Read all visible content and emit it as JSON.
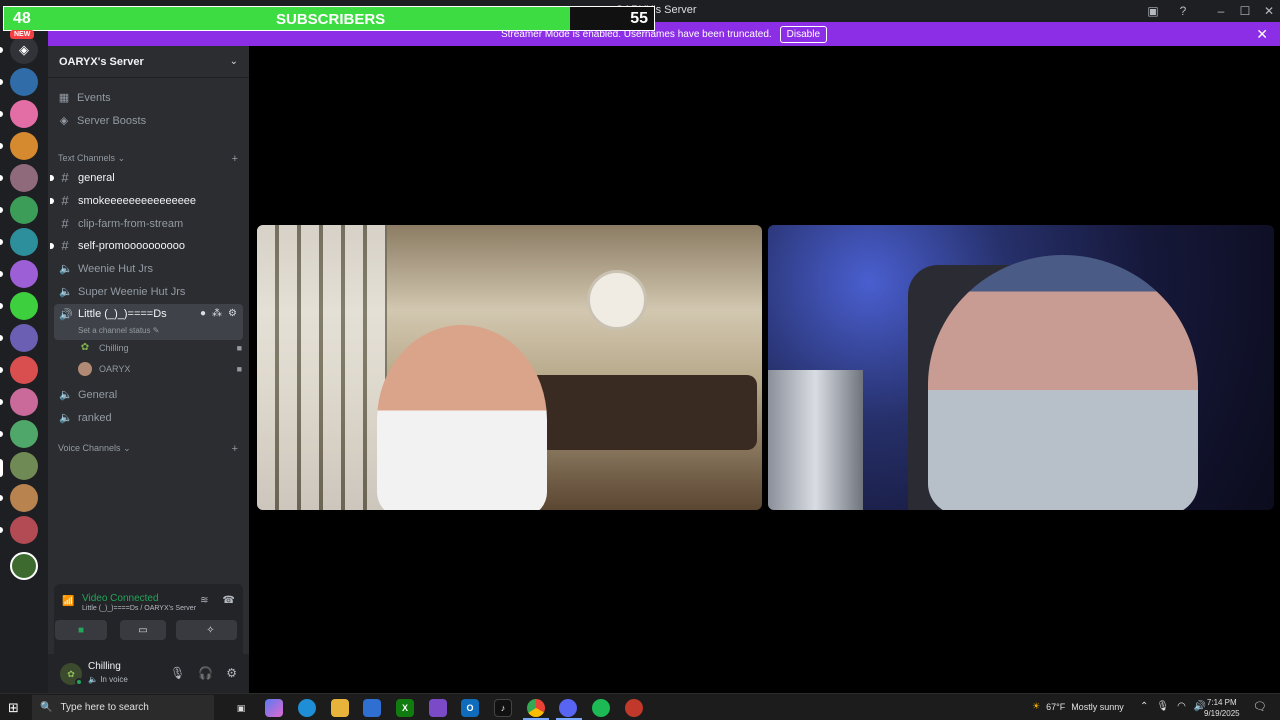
{
  "window": {
    "title": "OARYX's Server"
  },
  "overlay": {
    "count": "48",
    "label": "SUBSCRIBERS",
    "goal": "55",
    "progress": 0.87
  },
  "banner": {
    "text": "Streamer Mode is enabled. Usernames have been truncated.",
    "button": "Disable"
  },
  "rail": {
    "badge": "NEW"
  },
  "server": {
    "name": "OARYX's Server"
  },
  "nav": [
    {
      "label": "Events",
      "icon": "calendar-icon"
    },
    {
      "label": "Server Boosts",
      "icon": "boost-icon"
    }
  ],
  "categories": {
    "text": "Text Channels",
    "voice": "Voice Channels"
  },
  "channels": [
    {
      "name": "general",
      "type": "text",
      "unread": true
    },
    {
      "name": "smokeeeeeeeeeeeeeee",
      "type": "text",
      "unread": true
    },
    {
      "name": "clip-farm-from-stream",
      "type": "text",
      "unread": false
    },
    {
      "name": "self-promoooooooooo",
      "type": "text",
      "unread": true
    },
    {
      "name": "Weenie Hut Jrs",
      "type": "voice",
      "unread": false
    },
    {
      "name": "Super Weenie Hut Jrs",
      "type": "voice",
      "unread": false
    }
  ],
  "active_channel": {
    "name": "Little (_)_)====Ds",
    "status": "Set a channel status",
    "members": [
      {
        "name": "Chilling"
      },
      {
        "name": "OARYX"
      }
    ]
  },
  "more_channels": [
    {
      "name": "General"
    },
    {
      "name": "ranked"
    }
  ],
  "voice_panel": {
    "title": "Video Connected",
    "subtitle": "Little (_)_)====Ds / OARYX's Server"
  },
  "user": {
    "name": "Chilling",
    "status": "In voice"
  },
  "taskbar": {
    "search_placeholder": "Type here to search",
    "weather": {
      "temp": "67°F",
      "desc": "Mostly sunny"
    },
    "time": "7:14 PM",
    "date": "9/19/2025"
  }
}
